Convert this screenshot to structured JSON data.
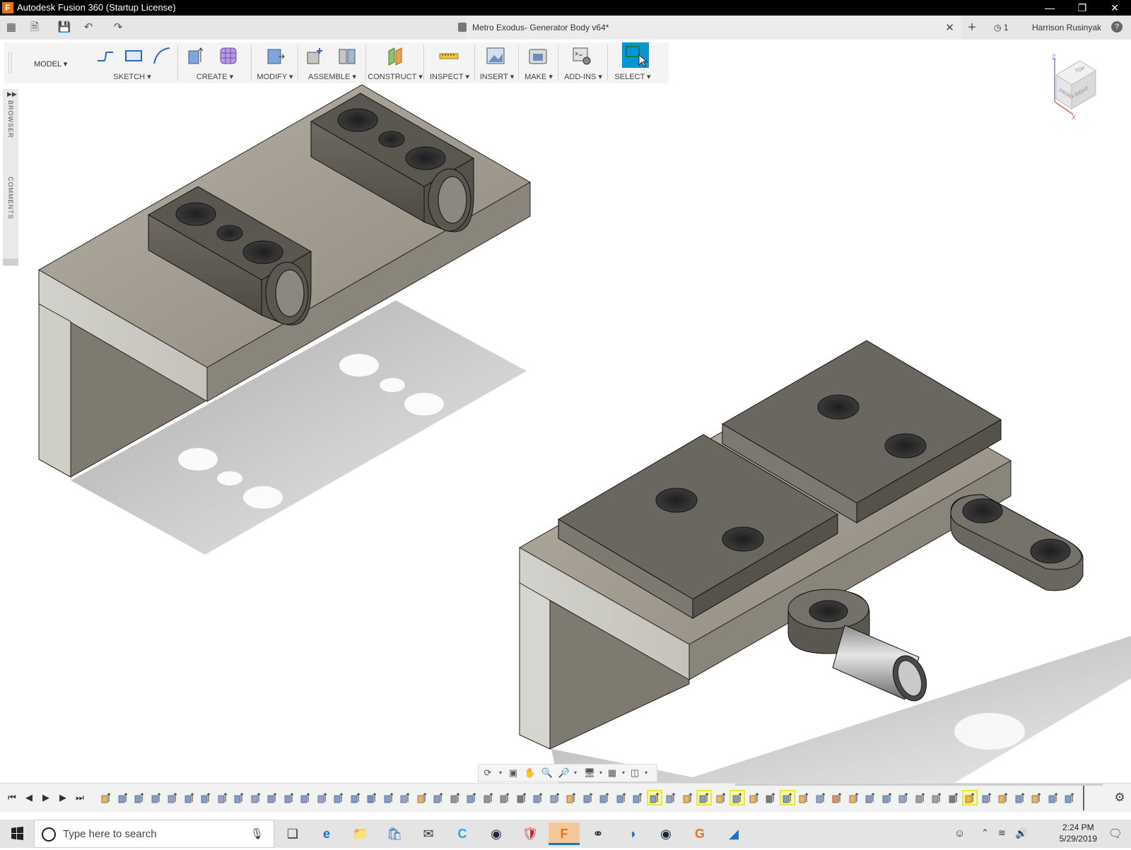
{
  "window": {
    "title": "Autodesk Fusion 360 (Startup License)",
    "controls": [
      "minimize-icon",
      "restore-icon",
      "close-icon"
    ]
  },
  "appbar": {
    "document_tab": "Metro Exodus- Generator Body v64*",
    "job_count": "1",
    "user_name": "Harrison Rusinyak"
  },
  "toolbar": {
    "workspace": "MODEL",
    "groups": [
      "SKETCH",
      "CREATE",
      "MODIFY",
      "ASSEMBLE",
      "CONSTRUCT",
      "INSPECT",
      "INSERT",
      "MAKE",
      "ADD-INS",
      "SELECT"
    ]
  },
  "side_panels": {
    "browser": "BROWSER",
    "comments": "COMMENTS"
  },
  "viewcube": {
    "top": "TOP",
    "front": "FRONT",
    "right": "RIGHT",
    "axis_z": "Z",
    "axis_x": "X"
  },
  "taskbar": {
    "search_placeholder": "Type here to search",
    "time": "2:24 PM",
    "date": "5/29/2019"
  },
  "colors": {
    "select_active": "#0696d7",
    "timeline_highlight": "#e8e83a",
    "titlebar": "#000000",
    "fusion_orange": "#e8711c"
  }
}
